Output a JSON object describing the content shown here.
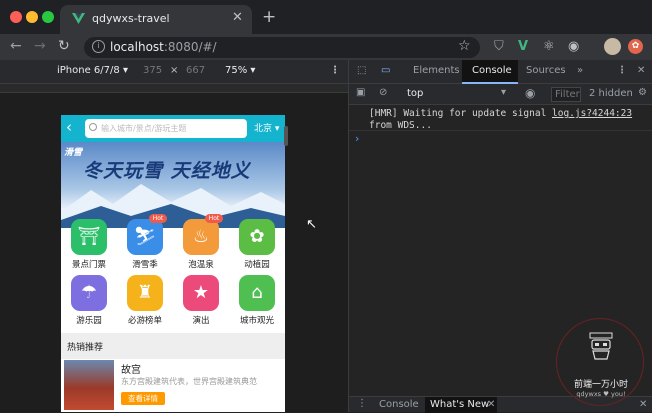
{
  "browser": {
    "tab_title": "qdywxs-travel",
    "url_host": "localhost",
    "url_path": ":8080/#/"
  },
  "device_toolbar": {
    "device": "iPhone 6/7/8 ▾",
    "width": "375",
    "times": "×",
    "height": "667",
    "zoom": "75% ▾"
  },
  "app": {
    "search_placeholder": "输入城市/景点/游玩主题",
    "city": "北京",
    "banner_title": "冬天玩雪 天经地义",
    "banner_logo": "滑雪",
    "icons": [
      {
        "label": "景点门票",
        "color": "#2bbf6a",
        "glyph": "⛩",
        "hot": false
      },
      {
        "label": "滑雪季",
        "color": "#3b8ee8",
        "glyph": "⛷",
        "hot": true
      },
      {
        "label": "泡温泉",
        "color": "#f39a3a",
        "glyph": "♨",
        "hot": true
      },
      {
        "label": "动植园",
        "color": "#5bbd44",
        "glyph": "✿",
        "hot": false
      },
      {
        "label": "游乐园",
        "color": "#7d6fe0",
        "glyph": "☂",
        "hot": false
      },
      {
        "label": "必游榜单",
        "color": "#f6b21a",
        "glyph": "♜",
        "hot": false
      },
      {
        "label": "演出",
        "color": "#ec4a7a",
        "glyph": "★",
        "hot": false
      },
      {
        "label": "城市观光",
        "color": "#4fbf52",
        "glyph": "⌂",
        "hot": false
      }
    ],
    "hot_badge": "Hot",
    "section_title": "热销推荐",
    "item_name": "故宫",
    "item_desc": "东方宫殿建筑代表，世界宫殿建筑典范",
    "item_button": "查看详情"
  },
  "devtools": {
    "tabs": [
      "Elements",
      "Console",
      "Sources",
      "»"
    ],
    "context": "top",
    "filter": "Filter",
    "hidden": "2 hidden",
    "message_line1": "[HMR] Waiting for update signal",
    "message_line2": "from WDS...",
    "message_source": "log.js?4244:23",
    "drawer_tabs": [
      "Console",
      "What's New"
    ]
  },
  "watermark": {
    "text": "前端一万小时",
    "sub": "qdywxs ♥ you!"
  }
}
